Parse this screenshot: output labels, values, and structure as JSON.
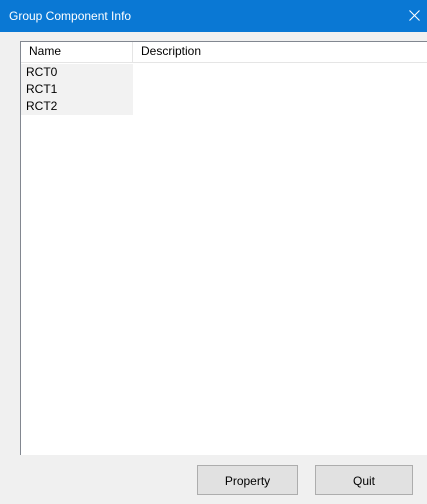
{
  "window": {
    "title": "Group Component Info",
    "title_bar_color": "#0a78d4",
    "close_icon": "close-icon"
  },
  "list": {
    "columns": [
      "Name",
      "Description"
    ],
    "rows": [
      {
        "name": "RCT0",
        "description": ""
      },
      {
        "name": "RCT1",
        "description": ""
      },
      {
        "name": "RCT2",
        "description": ""
      }
    ]
  },
  "buttons": {
    "property_label": "Property",
    "quit_label": "Quit"
  }
}
